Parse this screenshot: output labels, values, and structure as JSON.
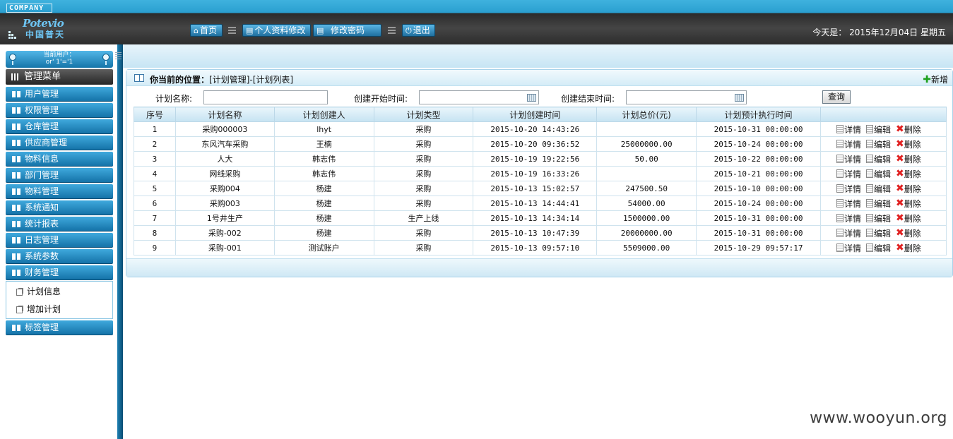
{
  "header": {
    "company_badge": "COMPANY",
    "logo_en": "Potevio",
    "logo_cn": "中国普天",
    "nav": [
      {
        "label": "首页",
        "icon": "home-icon"
      },
      {
        "label": "个人资料修改",
        "icon": "profile-icon"
      },
      {
        "label": "修改密码",
        "icon": "password-icon"
      },
      {
        "label": "退出",
        "icon": "power-icon"
      }
    ],
    "today_label": "今天是：",
    "today_date": "2015年12月04日",
    "today_weekday": "星期五"
  },
  "sidebar": {
    "user_label": "当前用户：",
    "user_value": "or' 1'='1",
    "menu_title": "管理菜单",
    "items": [
      "用户管理",
      "权限管理",
      "仓库管理",
      "供应商管理",
      "物料信息",
      "部门管理",
      "物料管理",
      "系统通知",
      "统计报表",
      "日志管理",
      "系统参数",
      "财务管理"
    ],
    "sub_items": [
      "计划信息",
      "增加计划"
    ],
    "last_item": "标签管理"
  },
  "location": {
    "label": "你当前的位置：",
    "path": "[计划管理]-[计划列表]",
    "add_label": "新增"
  },
  "search": {
    "name_label": "计划名称:",
    "name_value": "",
    "start_label": "创建开始时间:",
    "start_value": "",
    "end_label": "创建结束时间:",
    "end_value": "",
    "query_label": "查询"
  },
  "table": {
    "headers": [
      "序号",
      "计划名称",
      "计划创建人",
      "计划类型",
      "计划创建时间",
      "计划总价(元)",
      "计划预计执行时间",
      ""
    ],
    "rows": [
      [
        "1",
        "采购000003",
        "lhyt",
        "采购",
        "2015-10-20 14:43:26",
        "",
        "2015-10-31 00:00:00"
      ],
      [
        "2",
        "东风汽车采购",
        "王楠",
        "采购",
        "2015-10-20 09:36:52",
        "25000000.00",
        "2015-10-24 00:00:00"
      ],
      [
        "3",
        "人大",
        "韩志伟",
        "采购",
        "2015-10-19 19:22:56",
        "50.00",
        "2015-10-22 00:00:00"
      ],
      [
        "4",
        "网线采购",
        "韩志伟",
        "采购",
        "2015-10-19 16:33:26",
        "",
        "2015-10-21 00:00:00"
      ],
      [
        "5",
        "采购004",
        "杨建",
        "采购",
        "2015-10-13 15:02:57",
        "247500.50",
        "2015-10-10 00:00:00"
      ],
      [
        "6",
        "采购003",
        "杨建",
        "采购",
        "2015-10-13 14:44:41",
        "54000.00",
        "2015-10-24 00:00:00"
      ],
      [
        "7",
        "1号井生产",
        "杨建",
        "生产上线",
        "2015-10-13 14:34:14",
        "1500000.00",
        "2015-10-31 00:00:00"
      ],
      [
        "8",
        "采购-002",
        "杨建",
        "采购",
        "2015-10-13 10:47:39",
        "20000000.00",
        "2015-10-31 00:00:00"
      ],
      [
        "9",
        "采购-001",
        "测试账户",
        "采购",
        "2015-10-13 09:57:10",
        "5509000.00",
        "2015-10-29 09:57:17"
      ]
    ],
    "actions": {
      "detail": "详情",
      "edit": "编辑",
      "delete": "删除"
    }
  },
  "watermark": "www.wooyun.org"
}
